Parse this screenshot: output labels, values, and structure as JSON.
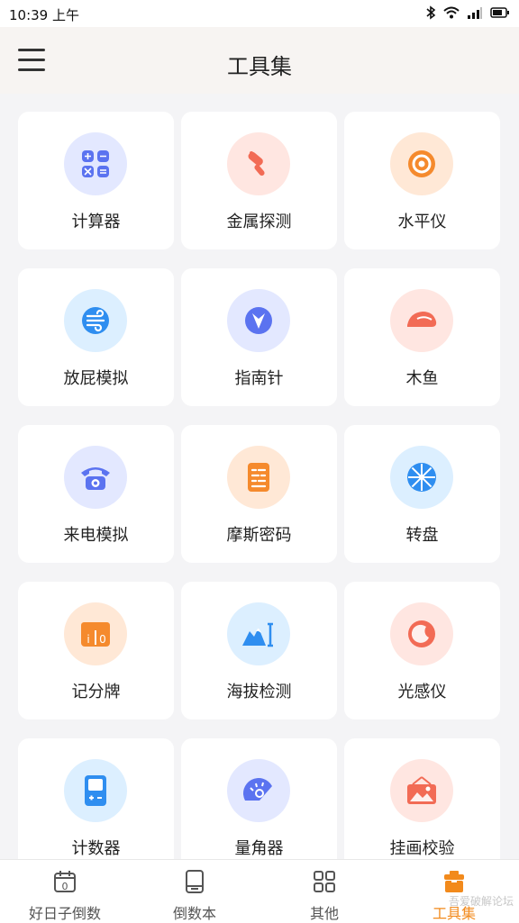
{
  "status_bar": {
    "time": "10:39 上午"
  },
  "header": {
    "title": "工具集"
  },
  "tools": [
    {
      "label": "计算器",
      "icon": "calculator-icon",
      "bg": "#e3e8ff",
      "fg": "#5b73f0"
    },
    {
      "label": "金属探测",
      "icon": "metal-detector-icon",
      "bg": "#ffe6e1",
      "fg": "#f26b55"
    },
    {
      "label": "水平仪",
      "icon": "level-icon",
      "bg": "#ffe8d6",
      "fg": "#f58a2d"
    },
    {
      "label": "放屁模拟",
      "icon": "wind-icon",
      "bg": "#dcefff",
      "fg": "#2f8ef0"
    },
    {
      "label": "指南针",
      "icon": "compass-icon",
      "bg": "#e3e8ff",
      "fg": "#5b73f0"
    },
    {
      "label": "木鱼",
      "icon": "wooden-fish-icon",
      "bg": "#ffe6e1",
      "fg": "#f26b55"
    },
    {
      "label": "来电模拟",
      "icon": "phone-icon",
      "bg": "#e3e8ff",
      "fg": "#5b73f0"
    },
    {
      "label": "摩斯密码",
      "icon": "morse-code-icon",
      "bg": "#ffe8d6",
      "fg": "#f58a2d"
    },
    {
      "label": "转盘",
      "icon": "wheel-icon",
      "bg": "#dcefff",
      "fg": "#2f8ef0"
    },
    {
      "label": "记分牌",
      "icon": "scoreboard-icon",
      "bg": "#ffe8d6",
      "fg": "#f58a2d"
    },
    {
      "label": "海拔检测",
      "icon": "altitude-icon",
      "bg": "#dcefff",
      "fg": "#2f8ef0"
    },
    {
      "label": "光感仪",
      "icon": "light-sensor-icon",
      "bg": "#ffe6e1",
      "fg": "#f26b55"
    },
    {
      "label": "计数器",
      "icon": "counter-icon",
      "bg": "#dcefff",
      "fg": "#2f8ef0"
    },
    {
      "label": "量角器",
      "icon": "protractor-icon",
      "bg": "#e3e8ff",
      "fg": "#5b73f0"
    },
    {
      "label": "挂画校验",
      "icon": "picture-frame-icon",
      "bg": "#ffe6e1",
      "fg": "#f26b55"
    }
  ],
  "nav": [
    {
      "label": "好日子倒数",
      "icon": "calendar-icon",
      "active": false
    },
    {
      "label": "倒数本",
      "icon": "notebook-icon",
      "active": false
    },
    {
      "label": "其他",
      "icon": "grid-icon",
      "active": false
    },
    {
      "label": "工具集",
      "icon": "toolbox-icon",
      "active": true
    }
  ],
  "accent": "#f28a1c",
  "watermark": "吾爱破解论坛"
}
